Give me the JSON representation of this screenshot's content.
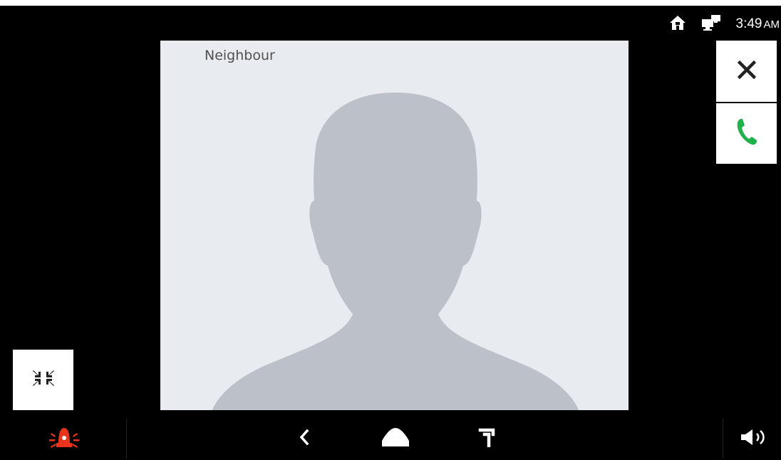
{
  "status_bar": {
    "time": "3:49",
    "ampm": "AM",
    "icons": [
      "home-icon",
      "desktop-monitor-icon"
    ]
  },
  "call": {
    "caller_name": "Neighbour"
  },
  "side_buttons": {
    "close_icon": "close-icon",
    "answer_icon": "phone-answer-icon"
  },
  "minimize_icon": "minimize-arrows-icon",
  "nav_bar": {
    "alarm_icon": "alarm-siren-icon",
    "items": [
      "back-icon",
      "home-icon",
      "recent-icon"
    ],
    "volume_icon": "volume-icon"
  },
  "colors": {
    "background": "#000000",
    "video_bg": "#e8ebf0",
    "silhouette": "#bcc1c9",
    "answer_green": "#1fb14a",
    "alarm_red": "#e8341c"
  }
}
